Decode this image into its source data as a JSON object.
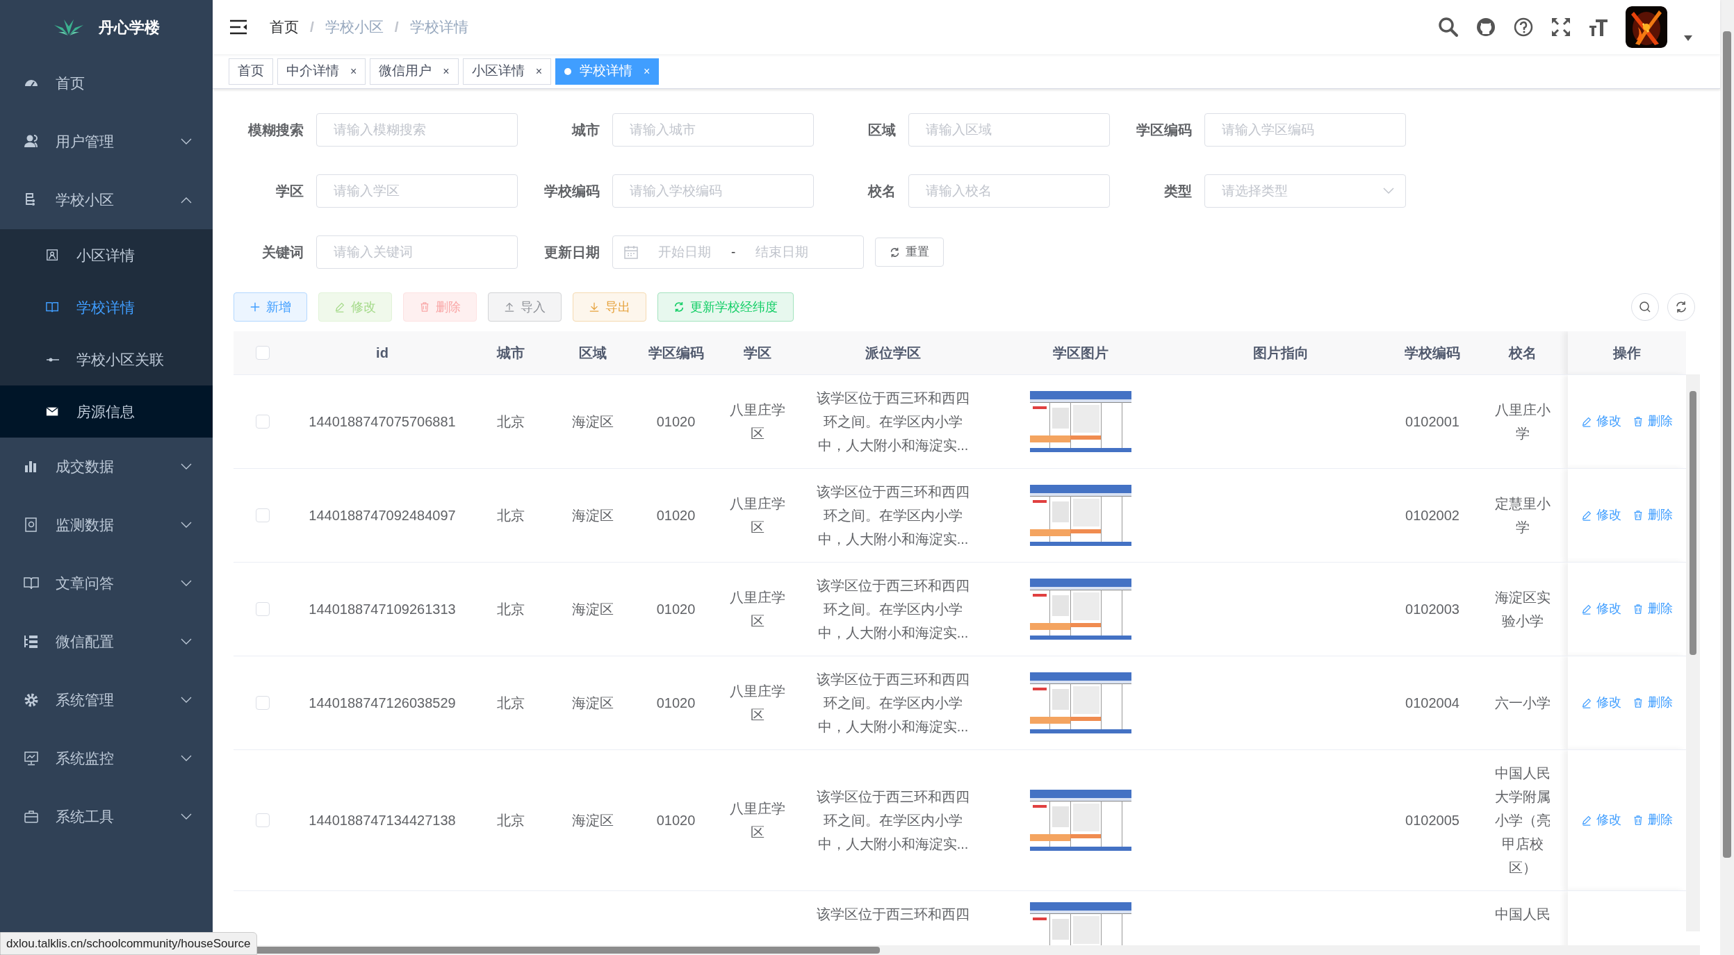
{
  "sidebar": {
    "logo": "丹心学楼",
    "items": [
      {
        "label": "首页"
      },
      {
        "label": "用户管理",
        "expanded": false
      },
      {
        "label": "学校小区",
        "expanded": true,
        "children": [
          {
            "label": "小区详情",
            "selected": false,
            "hovered": false
          },
          {
            "label": "学校详情",
            "selected": true,
            "hovered": false
          },
          {
            "label": "学校小区关联",
            "selected": false,
            "hovered": false
          },
          {
            "label": "房源信息",
            "selected": false,
            "hovered": true
          }
        ]
      },
      {
        "label": "成交数据",
        "expanded": false
      },
      {
        "label": "监测数据",
        "expanded": false
      },
      {
        "label": "文章问答",
        "expanded": false
      },
      {
        "label": "微信配置",
        "expanded": false
      },
      {
        "label": "系统管理",
        "expanded": false
      },
      {
        "label": "系统监控",
        "expanded": false
      },
      {
        "label": "系统工具",
        "expanded": false
      }
    ]
  },
  "breadcrumb": [
    "首页",
    "学校小区",
    "学校详情"
  ],
  "breadcrumb_separator": "/",
  "tabs": [
    {
      "label": "首页",
      "selected": false,
      "closable": false
    },
    {
      "label": "中介详情",
      "selected": false,
      "closable": true
    },
    {
      "label": "微信用户",
      "selected": false,
      "closable": true
    },
    {
      "label": "小区详情",
      "selected": false,
      "closable": true
    },
    {
      "label": "学校详情",
      "selected": true,
      "closable": true
    }
  ],
  "tab_close": "×",
  "filters": [
    {
      "label": "模糊搜索",
      "kind": "text",
      "placeholder": "请输入模糊搜索"
    },
    {
      "label": "城市",
      "kind": "text",
      "placeholder": "请输入城市"
    },
    {
      "label": "区域",
      "kind": "text",
      "placeholder": "请输入区域"
    },
    {
      "label": "学区编码",
      "kind": "text",
      "placeholder": "请输入学区编码"
    },
    {
      "label": "学区",
      "kind": "text",
      "placeholder": "请输入学区"
    },
    {
      "label": "学校编码",
      "kind": "text",
      "placeholder": "请输入学校编码"
    },
    {
      "label": "校名",
      "kind": "text",
      "placeholder": "请输入校名"
    },
    {
      "label": "类型",
      "kind": "select",
      "placeholder": "请选择类型"
    },
    {
      "label": "关键词",
      "kind": "text",
      "placeholder": "请输入关键词"
    },
    {
      "label": "更新日期",
      "kind": "daterange",
      "start_placeholder": "开始日期",
      "separator": "-",
      "end_placeholder": "结束日期"
    }
  ],
  "reset_button": "重置",
  "toolbar": [
    {
      "label": "新增",
      "kind": "add",
      "disabled": false
    },
    {
      "label": "修改",
      "kind": "edit",
      "disabled": true
    },
    {
      "label": "删除",
      "kind": "delete",
      "disabled": true
    },
    {
      "label": "导入",
      "kind": "import",
      "disabled": false
    },
    {
      "label": "导出",
      "kind": "export",
      "disabled": false
    },
    {
      "label": "更新学校经纬度",
      "kind": "refresh",
      "disabled": false
    }
  ],
  "table": {
    "all_selected": false,
    "columns": [
      "id",
      "城市",
      "区域",
      "学区编码",
      "学区",
      "派位学区",
      "学区图片",
      "图片指向",
      "学校编码",
      "校名"
    ],
    "action_column": "操作",
    "rows": [
      {
        "selected": false,
        "id": "1440188747075706881",
        "city": "北京",
        "district": "海淀区",
        "zone_code": "01020",
        "zone": "八里庄学区",
        "assigned": "该学区位于西三环和西四环之间。在学区内小学中，人大附小和海淀实...",
        "school_code": "0102001",
        "name": "八里庄小学",
        "actions": [
          "修改",
          "删除"
        ]
      },
      {
        "selected": false,
        "id": "1440188747092484097",
        "city": "北京",
        "district": "海淀区",
        "zone_code": "01020",
        "zone": "八里庄学区",
        "assigned": "该学区位于西三环和西四环之间。在学区内小学中，人大附小和海淀实...",
        "school_code": "0102002",
        "name": "定慧里小学",
        "actions": [
          "修改",
          "删除"
        ]
      },
      {
        "selected": false,
        "id": "1440188747109261313",
        "city": "北京",
        "district": "海淀区",
        "zone_code": "01020",
        "zone": "八里庄学区",
        "assigned": "该学区位于西三环和西四环之间。在学区内小学中，人大附小和海淀实...",
        "school_code": "0102003",
        "name": "海淀区实验小学",
        "actions": [
          "修改",
          "删除"
        ]
      },
      {
        "selected": false,
        "id": "1440188747126038529",
        "city": "北京",
        "district": "海淀区",
        "zone_code": "01020",
        "zone": "八里庄学区",
        "assigned": "该学区位于西三环和西四环之间。在学区内小学中，人大附小和海淀实...",
        "school_code": "0102004",
        "name": "六一小学",
        "actions": [
          "修改",
          "删除"
        ]
      },
      {
        "selected": false,
        "id": "1440188747134427138",
        "city": "北京",
        "district": "海淀区",
        "zone_code": "01020",
        "zone": "八里庄学区",
        "assigned": "该学区位于西三环和西四环之间。在学区内小学中，人大附小和海淀实...",
        "school_code": "0102005",
        "name": "中国人民大学附属小学（亮甲店校区）",
        "actions": [
          "修改",
          "删除"
        ]
      }
    ],
    "partial_row": {
      "assigned": "该学区位于西三环和西四",
      "name": "中国人民"
    }
  },
  "status_url": "dxlou.talklis.cn/schoolcommunity/houseSource"
}
